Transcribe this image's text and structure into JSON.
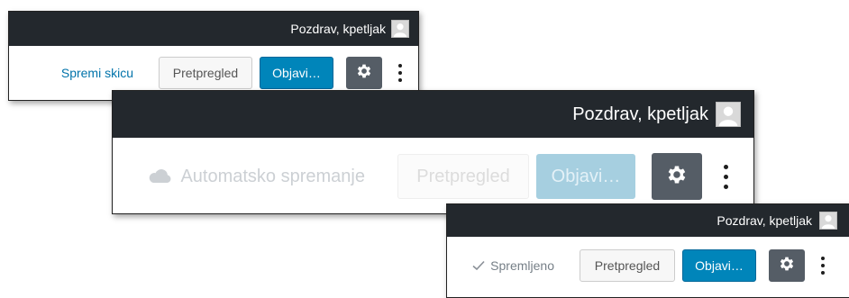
{
  "panel1": {
    "greeting": "Pozdrav, kpetljak",
    "save_draft": "Spremi skicu",
    "preview": "Pretpregled",
    "publish": "Objavi…"
  },
  "panel2": {
    "greeting": "Pozdrav, kpetljak",
    "autosave": "Automatsko spremanje",
    "preview": "Pretpregled",
    "publish": "Objavi…"
  },
  "panel3": {
    "greeting": "Pozdrav, kpetljak",
    "saved": "Spremljeno",
    "preview": "Pretpregled",
    "publish": "Objavi…"
  },
  "icons": {
    "avatar": "user-avatar-icon",
    "settings": "gear-icon",
    "more": "vertical-ellipsis-icon",
    "autosave": "cloud-icon",
    "saved": "check-icon"
  },
  "colors": {
    "admin_bar": "#23282d",
    "primary": "#0085ba",
    "link": "#0073aa",
    "gear_button": "#555d66"
  }
}
